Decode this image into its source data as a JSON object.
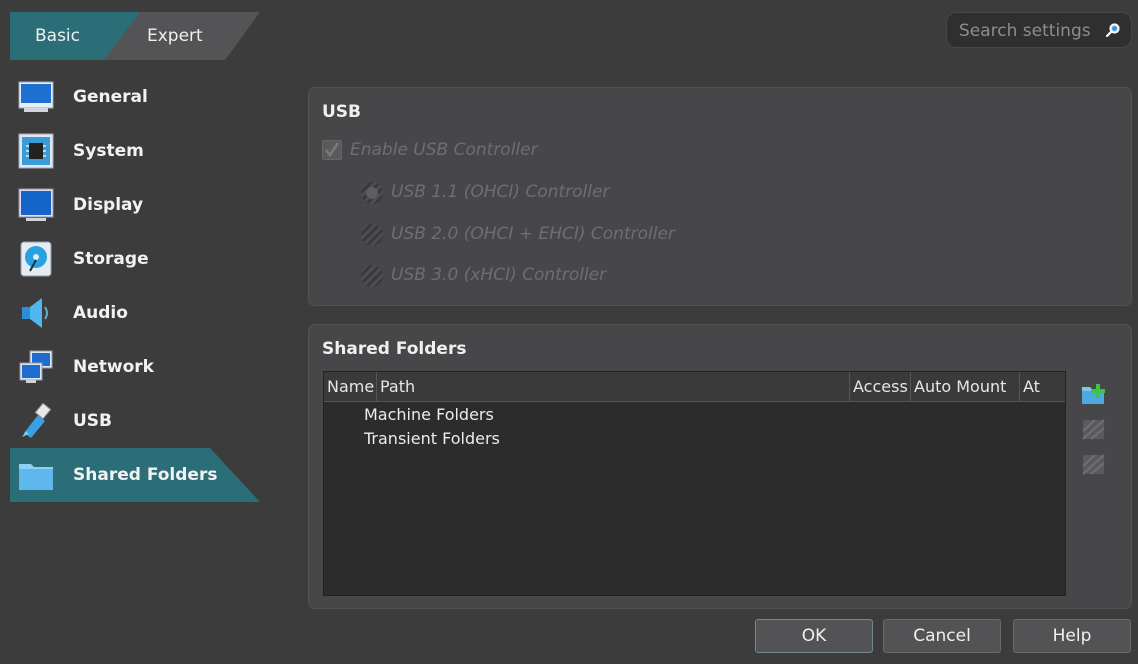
{
  "mode_tabs": {
    "basic": "Basic",
    "expert": "Expert",
    "active": "Basic"
  },
  "search": {
    "placeholder": "Search settings",
    "value": ""
  },
  "sidebar": {
    "items": [
      {
        "label": "General",
        "icon": "monitor-icon"
      },
      {
        "label": "System",
        "icon": "chip-icon"
      },
      {
        "label": "Display",
        "icon": "display-icon"
      },
      {
        "label": "Storage",
        "icon": "disk-icon"
      },
      {
        "label": "Audio",
        "icon": "speaker-icon"
      },
      {
        "label": "Network",
        "icon": "network-icon"
      },
      {
        "label": "USB",
        "icon": "usb-icon"
      },
      {
        "label": "Shared Folders",
        "icon": "folder-icon"
      }
    ],
    "selected": "Shared Folders"
  },
  "usb": {
    "title": "USB",
    "enable_label": "Enable USB Controller",
    "enabled_checked": true,
    "options": [
      {
        "label": "USB 1.1 (OHCI) Controller",
        "selected": true
      },
      {
        "label": "USB 2.0 (OHCI + EHCI) Controller",
        "selected": false
      },
      {
        "label": "USB 3.0 (xHCI) Controller",
        "selected": false
      }
    ]
  },
  "shared_folders": {
    "title": "Shared Folders",
    "columns": [
      "Name",
      "Path",
      "Access",
      "Auto Mount",
      "At"
    ],
    "rows": [
      "Machine Folders",
      "Transient Folders"
    ],
    "side_buttons": [
      "add-folder-icon",
      "edit-folder-icon",
      "remove-folder-icon"
    ]
  },
  "buttons": {
    "ok": "OK",
    "cancel": "Cancel",
    "help": "Help"
  },
  "colors": {
    "accent": "#2b6e78",
    "background": "#3c3c3d",
    "panel": "#474749"
  }
}
